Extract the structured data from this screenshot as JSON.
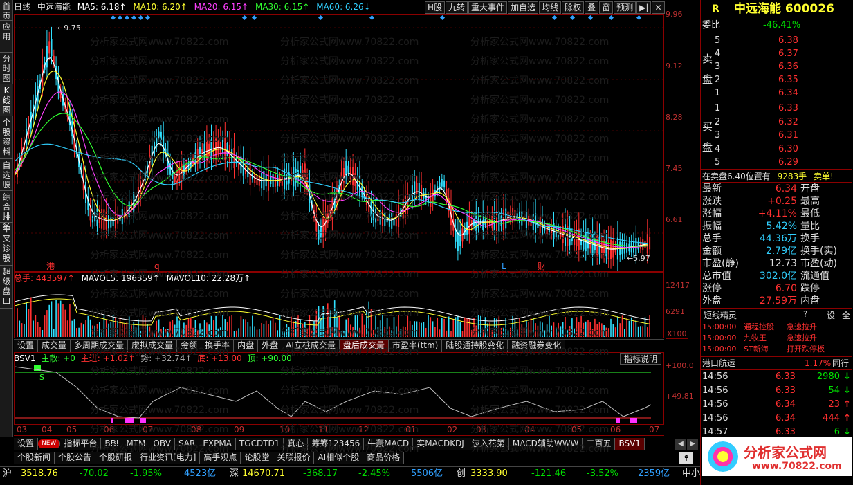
{
  "sidebar": {
    "items": [
      {
        "label": "首页",
        "active": false
      },
      {
        "label": "应用",
        "active": false
      },
      {
        "label": "分时图",
        "active": false
      },
      {
        "label": "K线图",
        "active": true
      },
      {
        "label": "个股资料",
        "active": false
      },
      {
        "label": "自选股",
        "active": false
      },
      {
        "label": "综合排名",
        "active": false
      },
      {
        "label": "牛叉诊股",
        "active": false
      },
      {
        "label": "超级盘口",
        "active": false
      }
    ]
  },
  "topbar": {
    "period": "日线",
    "stock": "中远海能",
    "ma5": "MA5: 6.18↑",
    "ma10": "MA10: 6.20↑",
    "ma20": "MA20: 6.15↑",
    "ma30": "MA30: 6.15↑",
    "ma60": "MA60: 6.26↓"
  },
  "toolbar": [
    "H股",
    "九转",
    "重大事件",
    "加自选",
    "均线",
    "除权",
    "叠",
    "窗",
    "预测",
    "▶|",
    "✕"
  ],
  "price_chart": {
    "y_labels": [
      "9.96",
      "9.12",
      "8.28",
      "7.45",
      "6.61"
    ],
    "high_mark": "9.75",
    "low_mark": "5.97",
    "events": [
      "港",
      "q",
      "L",
      "财"
    ]
  },
  "vol_chart": {
    "total": "总手: 443597↑",
    "mavol5": "MAVOL5: 196359↑",
    "mavol10": "MAVOL10: 22.28万↑",
    "y_labels": [
      "12417",
      "6291"
    ],
    "unit": "X100"
  },
  "tabs1": [
    {
      "label": "设置",
      "active": false
    },
    {
      "label": "成交量",
      "active": false
    },
    {
      "label": "多周期成交量",
      "active": false
    },
    {
      "label": "虚拟成交量",
      "active": false
    },
    {
      "label": "金额",
      "active": false
    },
    {
      "label": "换手率",
      "active": false
    },
    {
      "label": "内盘",
      "active": false
    },
    {
      "label": "外盘",
      "active": false
    },
    {
      "label": "AI立桩成交量",
      "active": false
    },
    {
      "label": "盘后成交量",
      "active": true
    },
    {
      "label": "市盈率(ttm)",
      "active": false
    },
    {
      "label": "陆股通持股变化",
      "active": false
    },
    {
      "label": "融资融券变化",
      "active": false
    }
  ],
  "bsv": {
    "name": "BSV1",
    "main": "主散: +0",
    "main_in": "主进: +1.02↑",
    "trend": "势: +32.74↑",
    "bottom": "底: +13.00",
    "top": "顶: +90.00",
    "btn": "指标说明",
    "y_labels": [
      "+100.0",
      "+49.81"
    ],
    "s_mark": "S"
  },
  "months": [
    "03",
    "04",
    "05",
    "06",
    "07",
    "08",
    "09",
    "10",
    "11",
    "12",
    "01",
    "02",
    "03",
    "04",
    "05",
    "06",
    "07"
  ],
  "tabs2": [
    {
      "label": "设置",
      "active": false
    },
    {
      "label": "NEW",
      "active": false
    },
    {
      "label": "指标平台",
      "active": false
    },
    {
      "label": "BBI",
      "active": false
    },
    {
      "label": "MTM",
      "active": false
    },
    {
      "label": "OBV",
      "active": false
    },
    {
      "label": "SAR",
      "active": false
    },
    {
      "label": "EXPMA",
      "active": false
    },
    {
      "label": "TGCDTD1",
      "active": false
    },
    {
      "label": "真心",
      "active": false
    },
    {
      "label": "筹筹123456",
      "active": false
    },
    {
      "label": "牛轰MACD",
      "active": false
    },
    {
      "label": "实MACDKDJ",
      "active": false
    },
    {
      "label": "波入花第",
      "active": false
    },
    {
      "label": "MACD辅助WWW",
      "active": false
    },
    {
      "label": "二百五",
      "active": false
    },
    {
      "label": "BSV1",
      "active": true
    }
  ],
  "tabs3": [
    {
      "label": "个股新闻"
    },
    {
      "label": "个股公告"
    },
    {
      "label": "个股研报"
    },
    {
      "label": "行业资讯[电力]"
    },
    {
      "label": "高手观点"
    },
    {
      "label": "论股堂"
    },
    {
      "label": "关联报价"
    },
    {
      "label": "AI相似个股"
    },
    {
      "label": "商品价格"
    }
  ],
  "status": {
    "sh_label": "沪",
    "sh": "3518.76",
    "sh_chg": "-70.02",
    "sh_pct": "-1.95%",
    "sh_amt": "4523亿",
    "sz_label": "深",
    "sz": "14670.71",
    "sz_chg": "-368.17",
    "sz_pct": "-2.45%",
    "sz_amt": "5506亿",
    "cy_label": "创",
    "cy": "3333.90",
    "cy_chg": "-121.46",
    "cy_pct": "-3.52%",
    "cy_amt": "2359亿",
    "zx": "中小"
  },
  "quote": {
    "r": "R",
    "name": "中远海能 600026",
    "wb_label": "委比",
    "wb": "-46.41%",
    "sell_label": "卖盘",
    "buy_label": "买盘",
    "sells": [
      {
        "n": "5",
        "p": "6.38"
      },
      {
        "n": "4",
        "p": "6.37"
      },
      {
        "n": "3",
        "p": "6.36"
      },
      {
        "n": "2",
        "p": "6.35"
      },
      {
        "n": "1",
        "p": "6.34"
      }
    ],
    "buys": [
      {
        "n": "1",
        "p": "6.33"
      },
      {
        "n": "2",
        "p": "6.32"
      },
      {
        "n": "3",
        "p": "6.31"
      },
      {
        "n": "4",
        "p": "6.30"
      },
      {
        "n": "5",
        "p": "6.29"
      }
    ],
    "notice": "在卖盘6.40位置有",
    "notice_vol": "9283手",
    "notice_tail": "卖单!",
    "stats": [
      {
        "l": "最新",
        "v": "6.34",
        "c": "red",
        "r": "开盘"
      },
      {
        "l": "涨跌",
        "v": "+0.25",
        "c": "red",
        "r": "最高"
      },
      {
        "l": "涨幅",
        "v": "+4.11%",
        "c": "red",
        "r": "最低"
      },
      {
        "l": "振幅",
        "v": "5.42%",
        "c": "cyan",
        "r": "量比"
      },
      {
        "l": "总手",
        "v": "44.36万",
        "c": "cyan",
        "r": "换手"
      },
      {
        "l": "金额",
        "v": "2.79亿",
        "c": "cyan",
        "r": "换手(实)"
      },
      {
        "l": "市盈(静)",
        "v": "12.73",
        "c": "white",
        "r": "市盈(动)"
      },
      {
        "l": "总市值",
        "v": "302.0亿",
        "c": "cyan",
        "r": "流通值"
      },
      {
        "l": "涨停",
        "v": "6.70",
        "c": "red",
        "r": "跌停"
      },
      {
        "l": "外盘",
        "v": "27.59万",
        "c": "red",
        "r": "内盘"
      }
    ],
    "elf_label": "短线精灵",
    "elf": [
      {
        "t": "15:00:00",
        "a": "通程控股",
        "b": "急速拉升"
      },
      {
        "t": "15:00:00",
        "a": "九牧王",
        "b": "急速拉升"
      },
      {
        "t": "15:00:00",
        "a": "ST新海",
        "b": "打开跌停板"
      }
    ],
    "sector": "港口航运",
    "sector_pct": "1.17%",
    "sector_btn": "同行",
    "ticks": [
      {
        "t": "14:56",
        "p": "6.33",
        "v": "2980",
        "d": "down"
      },
      {
        "t": "14:56",
        "p": "6.33",
        "v": "54",
        "d": "down"
      },
      {
        "t": "14:56",
        "p": "6.34",
        "v": "23",
        "d": "up"
      },
      {
        "t": "14:56",
        "p": "6.34",
        "v": "444",
        "d": "up"
      },
      {
        "t": "14:57",
        "p": "6.33",
        "v": "6",
        "d": "down"
      }
    ],
    "logo": "分析家公式网",
    "logo_url": "www.70822.com"
  },
  "watermark": "分析家公式网www.70822.com"
}
